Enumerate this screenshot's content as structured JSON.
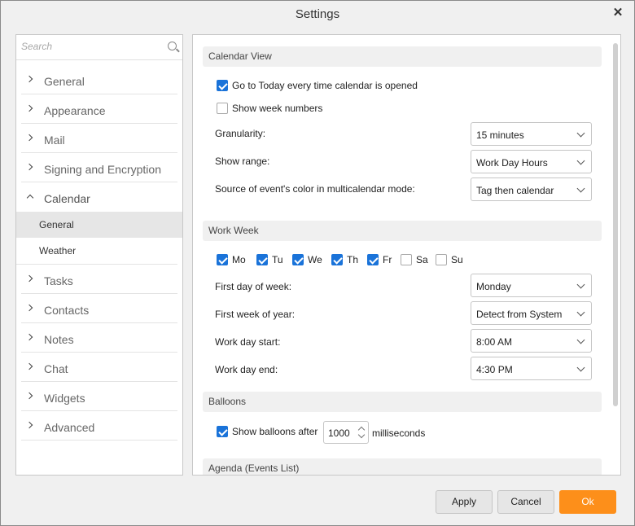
{
  "window": {
    "title": "Settings"
  },
  "search": {
    "placeholder": "Search"
  },
  "nav": {
    "items": [
      {
        "label": "General"
      },
      {
        "label": "Appearance"
      },
      {
        "label": "Mail"
      },
      {
        "label": "Signing and Encryption"
      },
      {
        "label": "Calendar"
      },
      {
        "label": "Tasks"
      },
      {
        "label": "Contacts"
      },
      {
        "label": "Notes"
      },
      {
        "label": "Chat"
      },
      {
        "label": "Widgets"
      },
      {
        "label": "Advanced"
      }
    ],
    "calendar_sub": [
      "General",
      "Weather"
    ]
  },
  "calendar_view": {
    "header": "Calendar View",
    "go_today": "Go to Today every time calendar is opened",
    "show_week_numbers": "Show week numbers",
    "granularity_label": "Granularity:",
    "granularity_value": "15 minutes",
    "show_range_label": "Show range:",
    "show_range_value": "Work Day Hours",
    "source_color_label": "Source of event's color in multicalendar mode:",
    "source_color_value": "Tag then calendar"
  },
  "work_week": {
    "header": "Work Week",
    "days": [
      {
        "label": "Mo",
        "checked": true
      },
      {
        "label": "Tu",
        "checked": true
      },
      {
        "label": "We",
        "checked": true
      },
      {
        "label": "Th",
        "checked": true
      },
      {
        "label": "Fr",
        "checked": true
      },
      {
        "label": "Sa",
        "checked": false
      },
      {
        "label": "Su",
        "checked": false
      }
    ],
    "first_day_label": "First day of week:",
    "first_day_value": "Monday",
    "first_week_label": "First week of year:",
    "first_week_value": "Detect from System",
    "start_label": "Work day start:",
    "start_value": "8:00 AM",
    "end_label": "Work day end:",
    "end_value": "4:30 PM"
  },
  "balloons": {
    "header": "Balloons",
    "show_after": "Show balloons after",
    "value": "1000",
    "unit": "milliseconds"
  },
  "agenda": {
    "header": "Agenda (Events List)"
  },
  "buttons": {
    "apply": "Apply",
    "cancel": "Cancel",
    "ok": "Ok"
  },
  "colors": {
    "accent": "#1a73d9",
    "ok_button": "#fd8f1a"
  }
}
